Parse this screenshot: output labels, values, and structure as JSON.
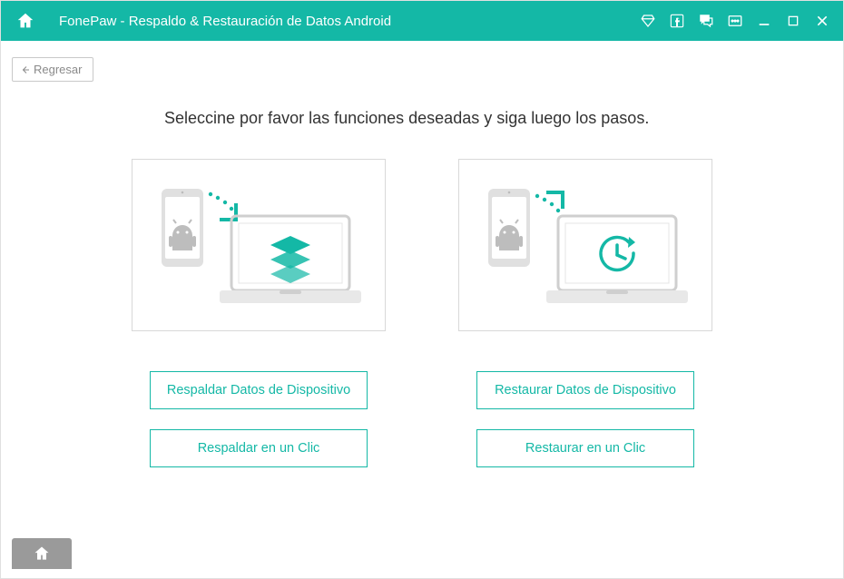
{
  "header": {
    "title": "FonePaw -  Respaldo & Restauración de Datos Android"
  },
  "back": {
    "label": "Regresar"
  },
  "main": {
    "instruction": "Seleccine por favor las funciones deseadas y siga luego los pasos."
  },
  "buttons": {
    "backup_device": "Respaldar Datos de Dispositivo",
    "restore_device": "Restaurar Datos de Dispositivo",
    "backup_one_click": "Respaldar en un Clic",
    "restore_one_click": "Restaurar en un Clic"
  },
  "colors": {
    "accent": "#14b8a6"
  }
}
